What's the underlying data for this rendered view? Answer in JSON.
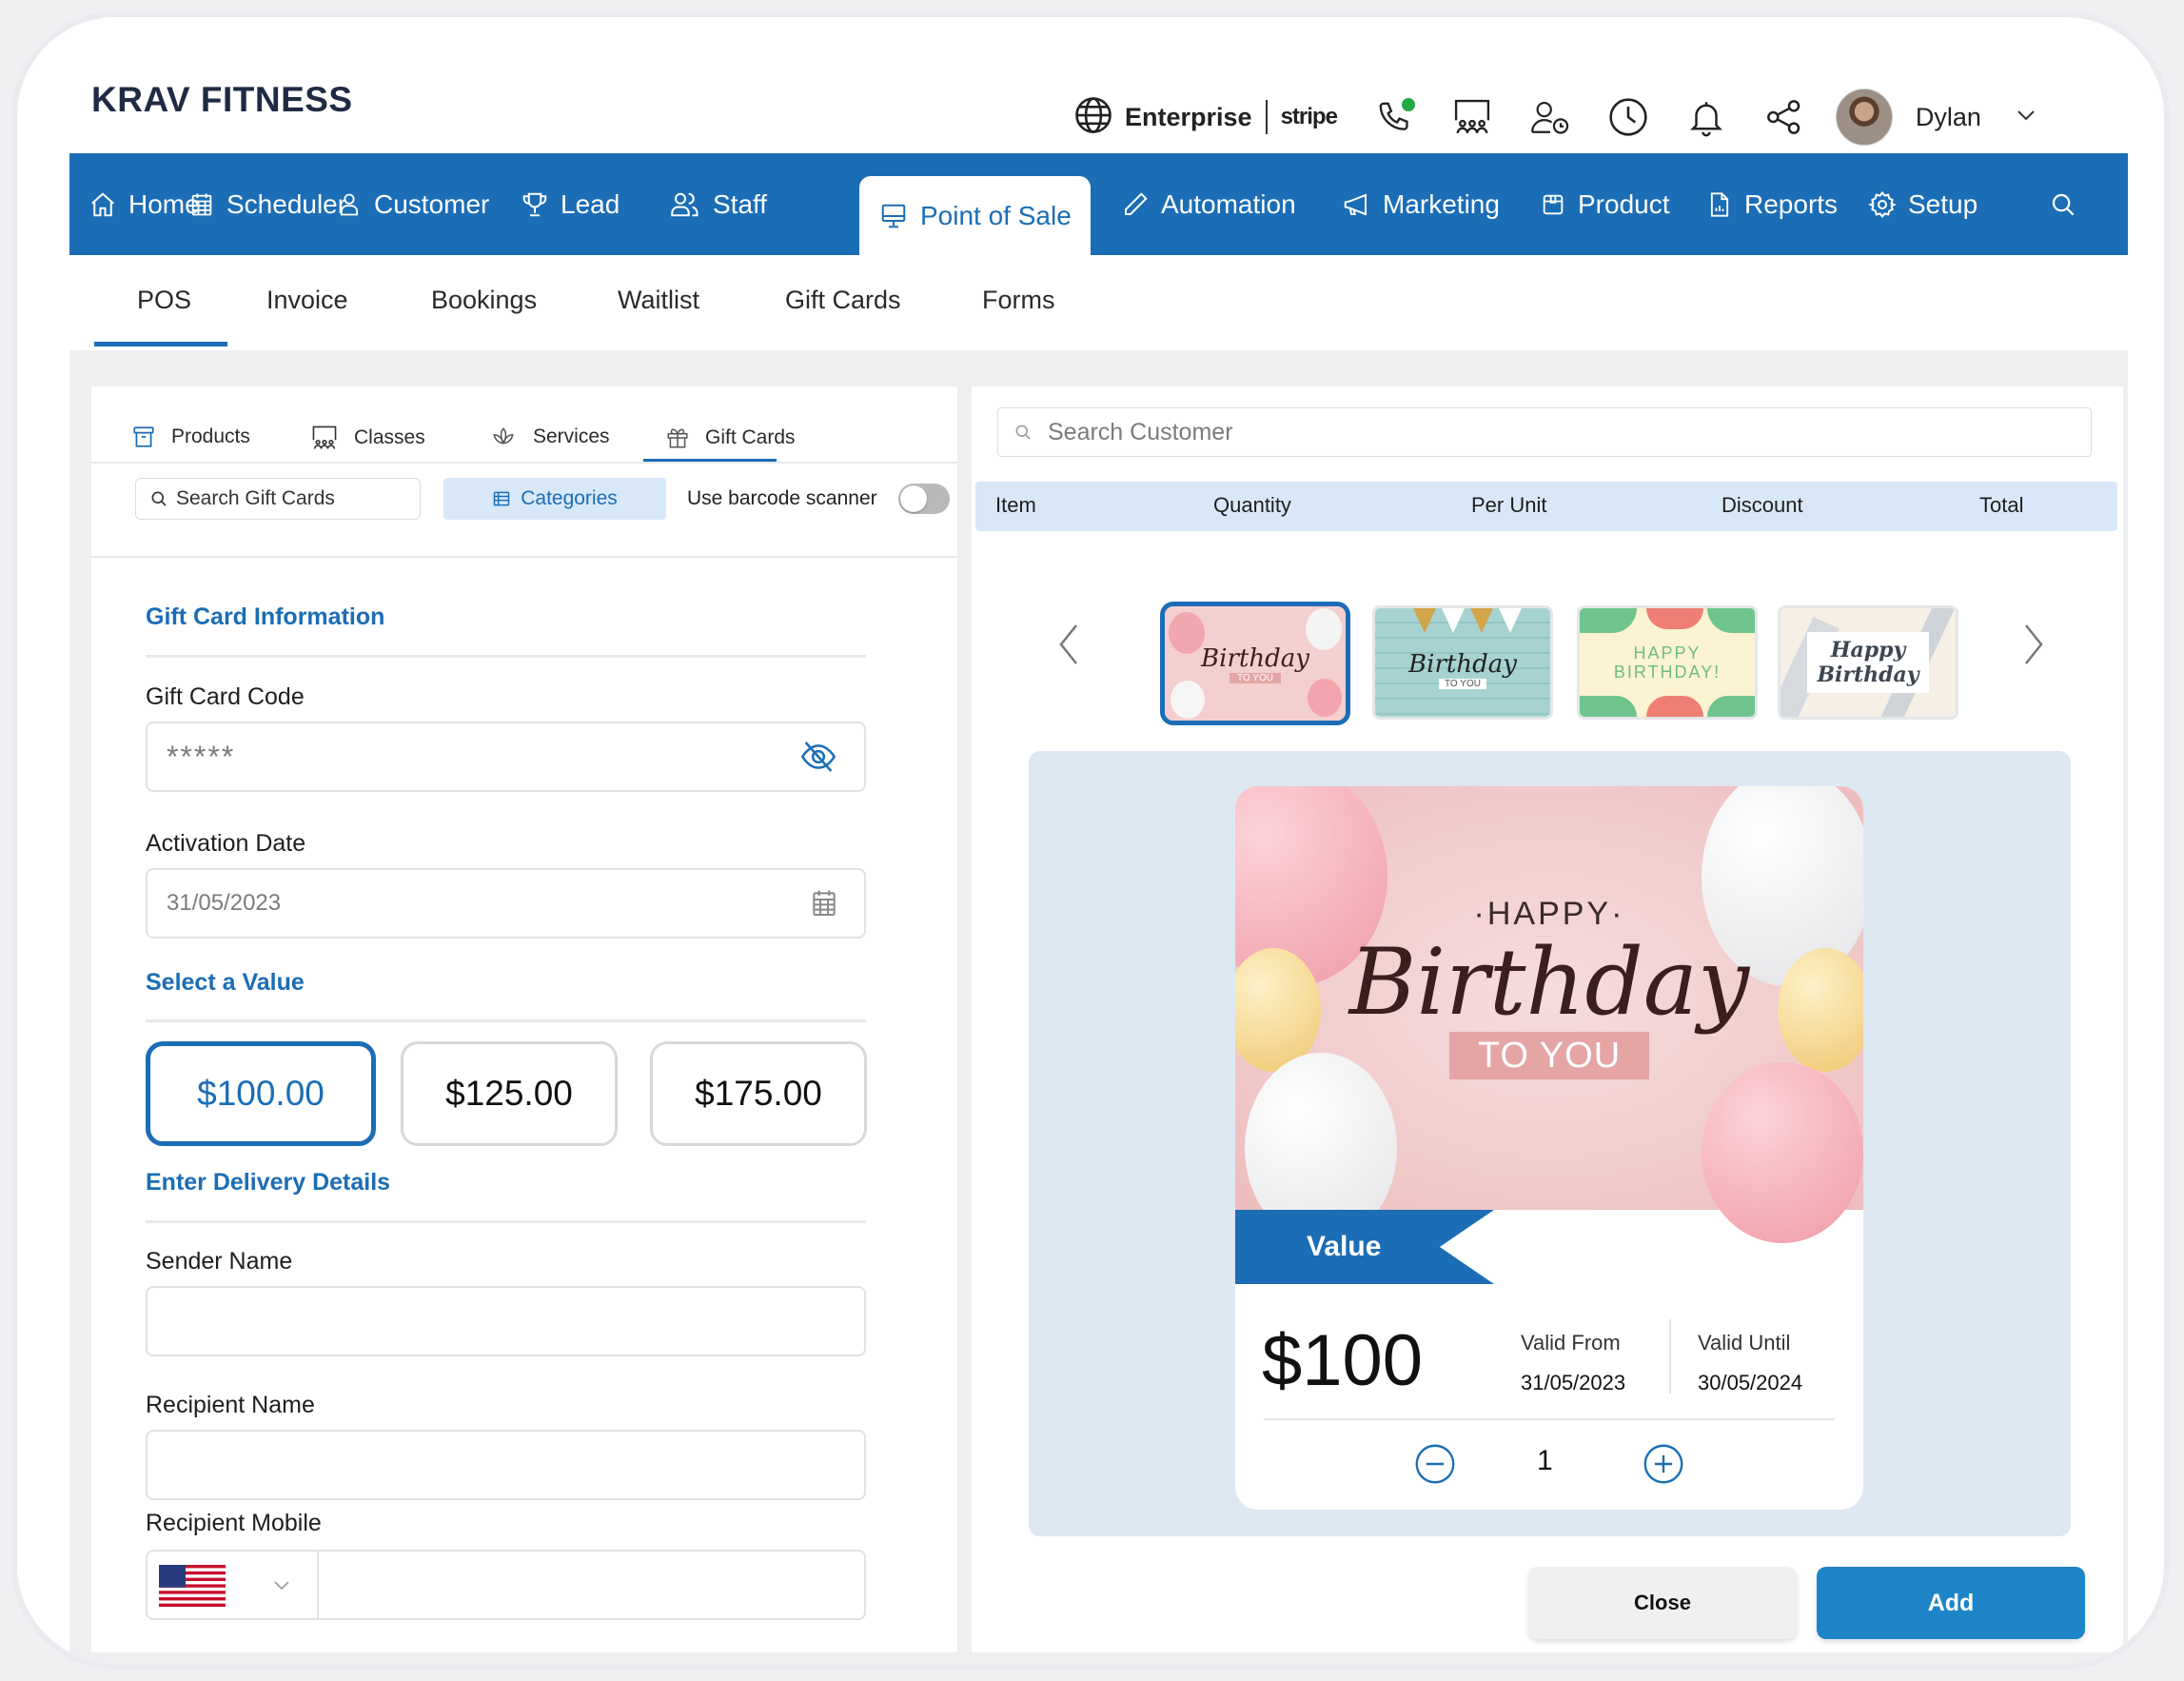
{
  "app": {
    "brand": "KRAV FITNESS",
    "plan": "Enterprise",
    "payment_provider": "stripe",
    "user_name": "Dylan",
    "status_dot_color": "#22aa44",
    "accent_color": "#1b6db5"
  },
  "header_icons": [
    "phone-icon",
    "classroom-icon",
    "user-clock-icon",
    "clock-icon",
    "bell-icon",
    "share-icon"
  ],
  "nav": {
    "items": [
      {
        "label": "Home",
        "icon": "home-icon"
      },
      {
        "label": "Scheduler",
        "icon": "calendar-icon"
      },
      {
        "label": "Customer",
        "icon": "user-icon"
      },
      {
        "label": "Lead",
        "icon": "trophy-icon"
      },
      {
        "label": "Staff",
        "icon": "users-icon"
      },
      {
        "label": "Point of Sale",
        "icon": "monitor-icon",
        "active": true
      },
      {
        "label": "Automation",
        "icon": "pencil-icon"
      },
      {
        "label": "Marketing",
        "icon": "megaphone-icon"
      },
      {
        "label": "Product",
        "icon": "box-icon"
      },
      {
        "label": "Reports",
        "icon": "report-icon"
      },
      {
        "label": "Setup",
        "icon": "gear-icon"
      }
    ],
    "search_icon": "search-icon"
  },
  "subtabs": [
    {
      "label": "POS",
      "active": true
    },
    {
      "label": "Invoice"
    },
    {
      "label": "Bookings"
    },
    {
      "label": "Waitlist"
    },
    {
      "label": "Gift Cards"
    },
    {
      "label": "Forms"
    }
  ],
  "left": {
    "tabs": [
      {
        "label": "Products"
      },
      {
        "label": "Classes"
      },
      {
        "label": "Services"
      },
      {
        "label": "Gift Cards",
        "active": true
      }
    ],
    "search_placeholder": "Search Gift Cards",
    "categories_label": "Categories",
    "barcode_label": "Use barcode scanner",
    "barcode_enabled": false,
    "gift_info_title": "Gift Card Information",
    "code_label": "Gift Card Code",
    "code_value": "*****",
    "activation_label": "Activation Date",
    "activation_value": "31/05/2023",
    "select_value_title": "Select a Value",
    "values": [
      "$100.00",
      "$125.00",
      "$175.00"
    ],
    "selected_value_index": 0,
    "delivery_title": "Enter Delivery Details",
    "sender_label": "Sender Name",
    "sender_value": "",
    "recipient_label": "Recipient Name",
    "recipient_value": "",
    "mobile_label": "Recipient Mobile",
    "mobile_country": "US",
    "mobile_value": ""
  },
  "right": {
    "search_placeholder": "Search Customer",
    "table_headers": [
      "Item",
      "Quantity",
      "Per Unit",
      "Discount",
      "Total"
    ],
    "designs": [
      {
        "name": "Happy Birthday To You (balloons)",
        "selected": true
      },
      {
        "name": "Happy Birthday To You (bunting)"
      },
      {
        "name": "Happy Birthday!"
      },
      {
        "name": "Happy Birthday (script)"
      }
    ],
    "card": {
      "happy": "·HAPPY·",
      "birthday": "Birthday",
      "to_you": "TO YOU",
      "value_label": "Value",
      "amount": "$100",
      "valid_from_label": "Valid From",
      "valid_from": "31/05/2023",
      "valid_until_label": "Valid Until",
      "valid_until": "30/05/2024",
      "quantity": "1"
    },
    "close_label": "Close",
    "add_label": "Add"
  }
}
